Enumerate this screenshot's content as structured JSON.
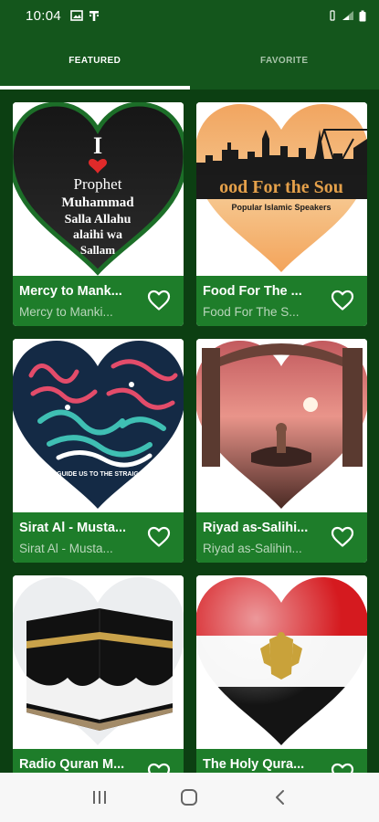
{
  "status_bar": {
    "time": "10:04"
  },
  "tabs": [
    {
      "label": "FEATURED",
      "active": true
    },
    {
      "label": "FAVORITE",
      "active": false
    }
  ],
  "stations": [
    {
      "title": "Mercy to Mank...",
      "subtitle": "Mercy to Manki...",
      "image_text": [
        "I",
        "Prophet",
        "Muhammad",
        "Salla Allahu",
        "alaihi wa",
        "Sallam"
      ]
    },
    {
      "title": "Food For The ...",
      "subtitle": "Food For The  S...",
      "image_text": [
        "ood For the Sou",
        "Popular Islamic Speakers"
      ]
    },
    {
      "title": "Sirat Al - Musta...",
      "subtitle": "Sirat Al - Musta...",
      "image_text": [
        "GUIDE  US TO THE STRAIG"
      ]
    },
    {
      "title": "Riyad as-Salihi...",
      "subtitle": "Riyad as-Salihin...",
      "image_text": []
    },
    {
      "title": "Radio Quran M...",
      "subtitle": "",
      "image_text": []
    },
    {
      "title": "The Holy Qura...",
      "subtitle": "",
      "image_text": []
    }
  ],
  "icons": {
    "favorite": "heart-outline-icon",
    "nav_recents": "recents-icon",
    "nav_home": "home-icon",
    "nav_back": "back-icon"
  },
  "colors": {
    "app_bar": "#14561c",
    "background": "#0c3f12",
    "card_footer": "#1e7d2a",
    "nav_bar": "#f7f7f7"
  }
}
